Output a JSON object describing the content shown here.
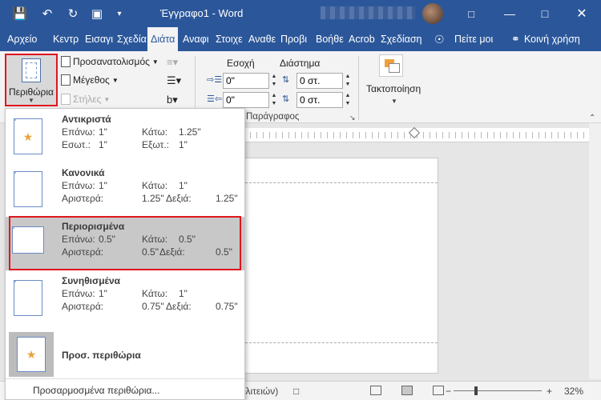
{
  "titlebar": {
    "title": "Έγγραφο1 - Word",
    "icons": [
      "save-icon",
      "undo-icon",
      "redo-icon",
      "touch-mode-icon",
      "customize-icon"
    ],
    "window": [
      "ribbon-options-icon",
      "minimize-icon",
      "maximize-icon",
      "close-icon"
    ]
  },
  "tabs": [
    {
      "label": "Αρχείο"
    },
    {
      "label": "Κεντρ"
    },
    {
      "label": "Εισαγι"
    },
    {
      "label": "Σχεδία"
    },
    {
      "label": "Διάτα"
    },
    {
      "label": "Αναφι"
    },
    {
      "label": "Στοιχε"
    },
    {
      "label": "Αναθε"
    },
    {
      "label": "Προβι"
    },
    {
      "label": "Βοήθε"
    },
    {
      "label": "Acrob"
    },
    {
      "label": "Σχεδίαση"
    },
    {
      "label": "Πείτε μοι"
    },
    {
      "label": "Κοινή χρήση"
    }
  ],
  "ribbon": {
    "margins_label": "Περιθώρια",
    "orientation_label": "Προσανατολισμός",
    "size_label": "Μέγεθος",
    "columns_label": "Στήλες",
    "indent_label": "Εσοχή",
    "spacing_label": "Διάστημα",
    "indent_left": "0\"",
    "indent_right": "0\"",
    "spacing_before": "0 στ.",
    "spacing_after": "0 στ.",
    "paragraph_group": "Παράγραφος",
    "arrange_label": "Τακτοποίηση"
  },
  "margins_menu": {
    "options": [
      {
        "name": "Αντικριστά",
        "top_label": "Επάνω:",
        "top": "1\"",
        "bottom_label": "Κάτω:",
        "bottom": "1.25\"",
        "left_label": "Εσωτ.:",
        "left": "1\"",
        "right_label": "Εξωτ.:",
        "right": "1\""
      },
      {
        "name": "Κανονικά",
        "top_label": "Επάνω:",
        "top": "1\"",
        "bottom_label": "Κάτω:",
        "bottom": "1\"",
        "left_label": "Αριστερά:",
        "left": "1.25\"",
        "right_label": "Δεξιά:",
        "right": "1.25\""
      },
      {
        "name": "Περιορισμένα",
        "top_label": "Επάνω:",
        "top": "0.5\"",
        "bottom_label": "Κάτω:",
        "bottom": "0.5\"",
        "left_label": "Αριστερά:",
        "left": "0.5\"",
        "right_label": "Δεξιά:",
        "right": "0.5\""
      },
      {
        "name": "Συνηθισμένα",
        "top_label": "Επάνω:",
        "top": "1\"",
        "bottom_label": "Κάτω:",
        "bottom": "1\"",
        "left_label": "Αριστερά:",
        "left": "0.75\"",
        "right_label": "Δεξιά:",
        "right": "0.75\""
      }
    ],
    "custom_last": "Προσ. περιθώρια",
    "custom_link": "Προσαρμοσμένα περιθώρια..."
  },
  "status": {
    "language": "ολιτειών)",
    "zoom": "32%"
  },
  "colors": {
    "accent": "#2b579a",
    "highlight_border": "#e0161f"
  }
}
